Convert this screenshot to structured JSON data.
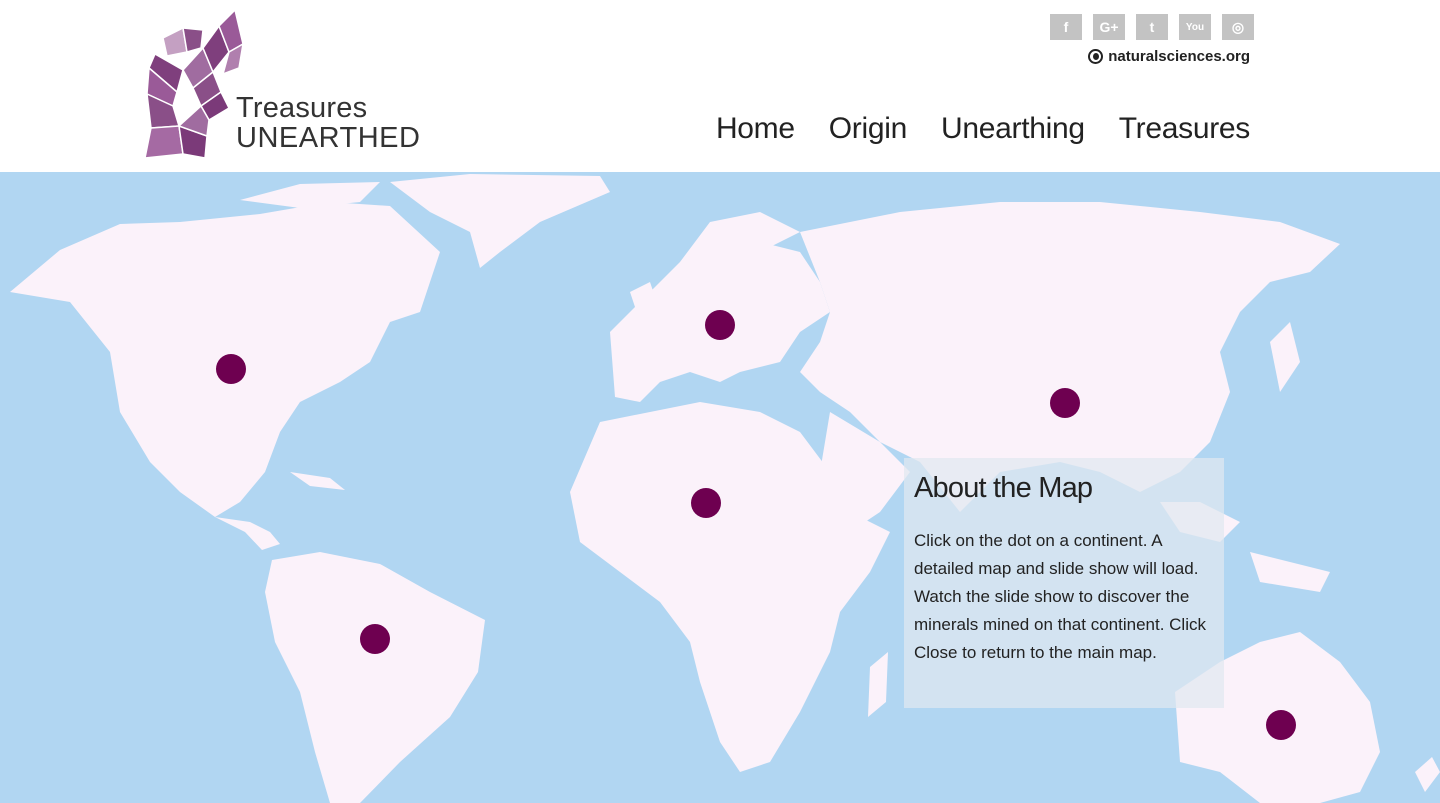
{
  "brand": {
    "line1": "Treasures",
    "line2": "UNEARTHED"
  },
  "social": [
    {
      "name": "facebook-icon",
      "glyph": "f"
    },
    {
      "name": "google-plus-icon",
      "glyph": "G+"
    },
    {
      "name": "twitter-icon",
      "glyph": "t"
    },
    {
      "name": "youtube-icon",
      "glyph": "You"
    },
    {
      "name": "instagram-icon",
      "glyph": "◎"
    }
  ],
  "partner": {
    "label": "naturalsciences.org"
  },
  "nav": [
    "Home",
    "Origin",
    "Unearthing",
    "Treasures"
  ],
  "map": {
    "markers": [
      "north-america",
      "europe",
      "asia",
      "africa",
      "south-america",
      "australia"
    ]
  },
  "about": {
    "title": "About the Map",
    "body": "Click on the dot on a continent. A detailed map and slide show will load. Watch the slide show to discover the minerals mined on that continent. Click Close to return to the main map."
  },
  "colors": {
    "ocean": "#b1d6f2",
    "land": "#fbf2fa",
    "marker": "#6e0050",
    "logo": "#8a4f88"
  }
}
